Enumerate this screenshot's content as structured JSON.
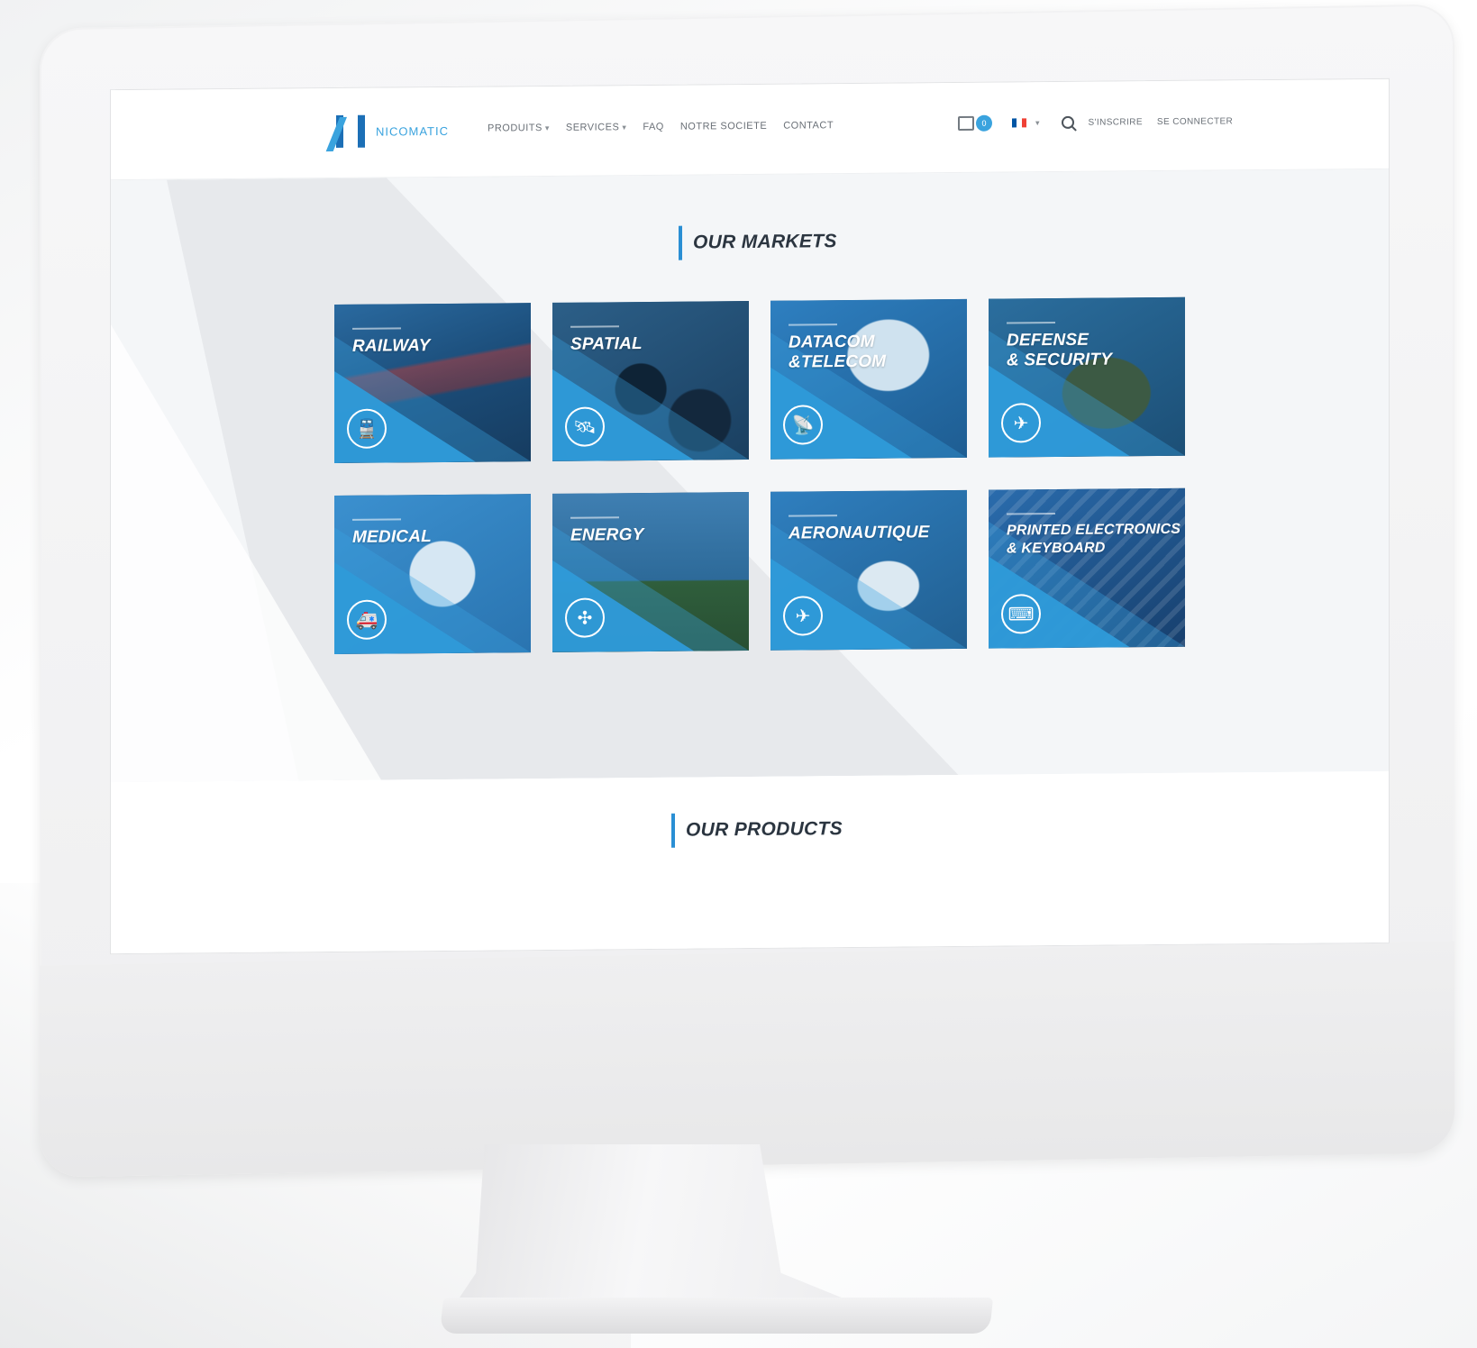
{
  "brand": {
    "name": "NICOMATIC",
    "logo_color": "#1c6fb6",
    "accent_color": "#3aa3de"
  },
  "nav": {
    "items": [
      {
        "label": "PRODUITS",
        "has_dropdown": true
      },
      {
        "label": "SERVICES",
        "has_dropdown": true
      },
      {
        "label": "FAQ",
        "has_dropdown": false
      },
      {
        "label": "NOTRE SOCIETE",
        "has_dropdown": false
      },
      {
        "label": "CONTACT",
        "has_dropdown": false
      }
    ],
    "caret": "▾"
  },
  "header_right": {
    "cart_count": "0",
    "language_flag": {
      "colors": [
        "#0055a4",
        "#ffffff",
        "#ef4135"
      ]
    },
    "language_caret": "▾",
    "register_label": "S'INSCRIRE",
    "login_label": "SE CONNECTER"
  },
  "markets": {
    "title": "OUR MARKETS",
    "tiles": [
      {
        "title_lines": [
          "RAILWAY",
          ""
        ],
        "icon": "train-icon",
        "glyph": "🚆"
      },
      {
        "title_lines": [
          "SPATIAL",
          ""
        ],
        "icon": "satellite-icon",
        "glyph": "🛰"
      },
      {
        "title_lines": [
          "DATACOM",
          "&TELECOM"
        ],
        "icon": "antenna-icon",
        "glyph": "📡"
      },
      {
        "title_lines": [
          "DEFENSE",
          "& SECURITY"
        ],
        "icon": "jet-icon",
        "glyph": "✈"
      },
      {
        "title_lines": [
          "MEDICAL",
          ""
        ],
        "icon": "ambulance-icon",
        "glyph": "🚑"
      },
      {
        "title_lines": [
          "ENERGY",
          ""
        ],
        "icon": "wind-turbine-icon",
        "glyph": "✣"
      },
      {
        "title_lines": [
          "AERONAUTIQUE",
          ""
        ],
        "icon": "plane-icon",
        "glyph": "✈"
      },
      {
        "title_lines": [
          "PRINTED ELECTRONICS",
          "& KEYBOARD"
        ],
        "icon": "keyboard-icon",
        "glyph": "⌨"
      }
    ]
  },
  "products": {
    "title": "OUR PRODUCTS"
  }
}
